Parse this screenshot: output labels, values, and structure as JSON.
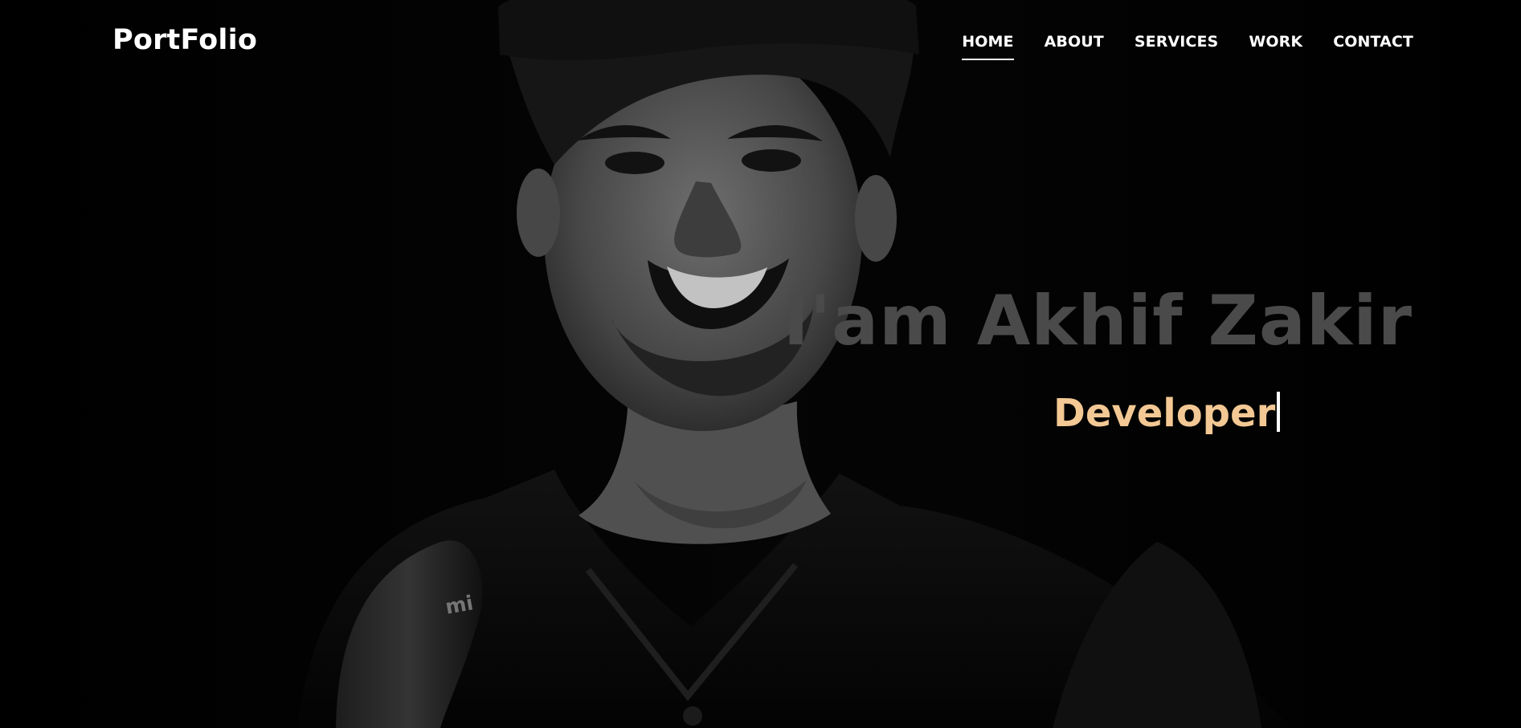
{
  "site": {
    "brand": "PortFolio"
  },
  "nav": {
    "items": [
      {
        "label": "HOME",
        "active": true
      },
      {
        "label": "ABOUT",
        "active": false
      },
      {
        "label": "SERVICES",
        "active": false
      },
      {
        "label": "WORK",
        "active": false
      },
      {
        "label": "CONTACT",
        "active": false
      }
    ]
  },
  "hero": {
    "title": "I'am Akhif Zakir",
    "role": "Developer",
    "cursor_icon": "typing-cursor-icon",
    "logo_mark": "mi",
    "colors": {
      "title": "#4a4a4a",
      "role": "#f3c894",
      "background": "#030303"
    }
  }
}
